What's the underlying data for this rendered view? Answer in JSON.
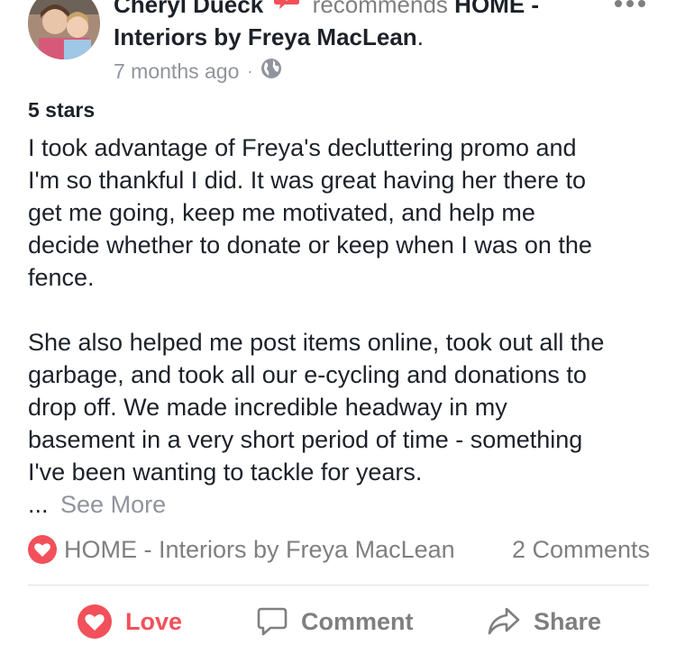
{
  "post": {
    "author": "Cheryl Dueck",
    "recommends_text": "recommends",
    "page_name_line1": "HOME -",
    "page_name_line2": "Interiors by Freya MacLean",
    "page_name_period": ".",
    "timestamp": "7 months ago",
    "separator": "·",
    "audience_icon": "globe-icon"
  },
  "review": {
    "rating": "5 stars",
    "paragraph1": [
      "I took advantage of Freya's decluttering promo and",
      "I'm so thankful I did. It was great having her there to",
      "get me going, keep me motivated, and help me",
      "decide whether to donate or keep when I was on the",
      "fence."
    ],
    "paragraph2": [
      "She also helped me post items online, took out all the",
      "garbage, and took all our e-cycling and donations to",
      "drop off. We made incredible headway in my",
      "basement in a very short period of time - something",
      "I've been wanting to tackle for years."
    ],
    "ellipsis": "...",
    "see_more": "See More"
  },
  "reactions": {
    "reacted_by": "HOME - Interiors by Freya MacLean",
    "comments_count": "2 Comments"
  },
  "actions": {
    "love": "Love",
    "comment": "Comment",
    "share": "Share"
  },
  "colors": {
    "love_red": "#f2505a",
    "muted_gray": "#90949c",
    "text": "#1d2129"
  }
}
